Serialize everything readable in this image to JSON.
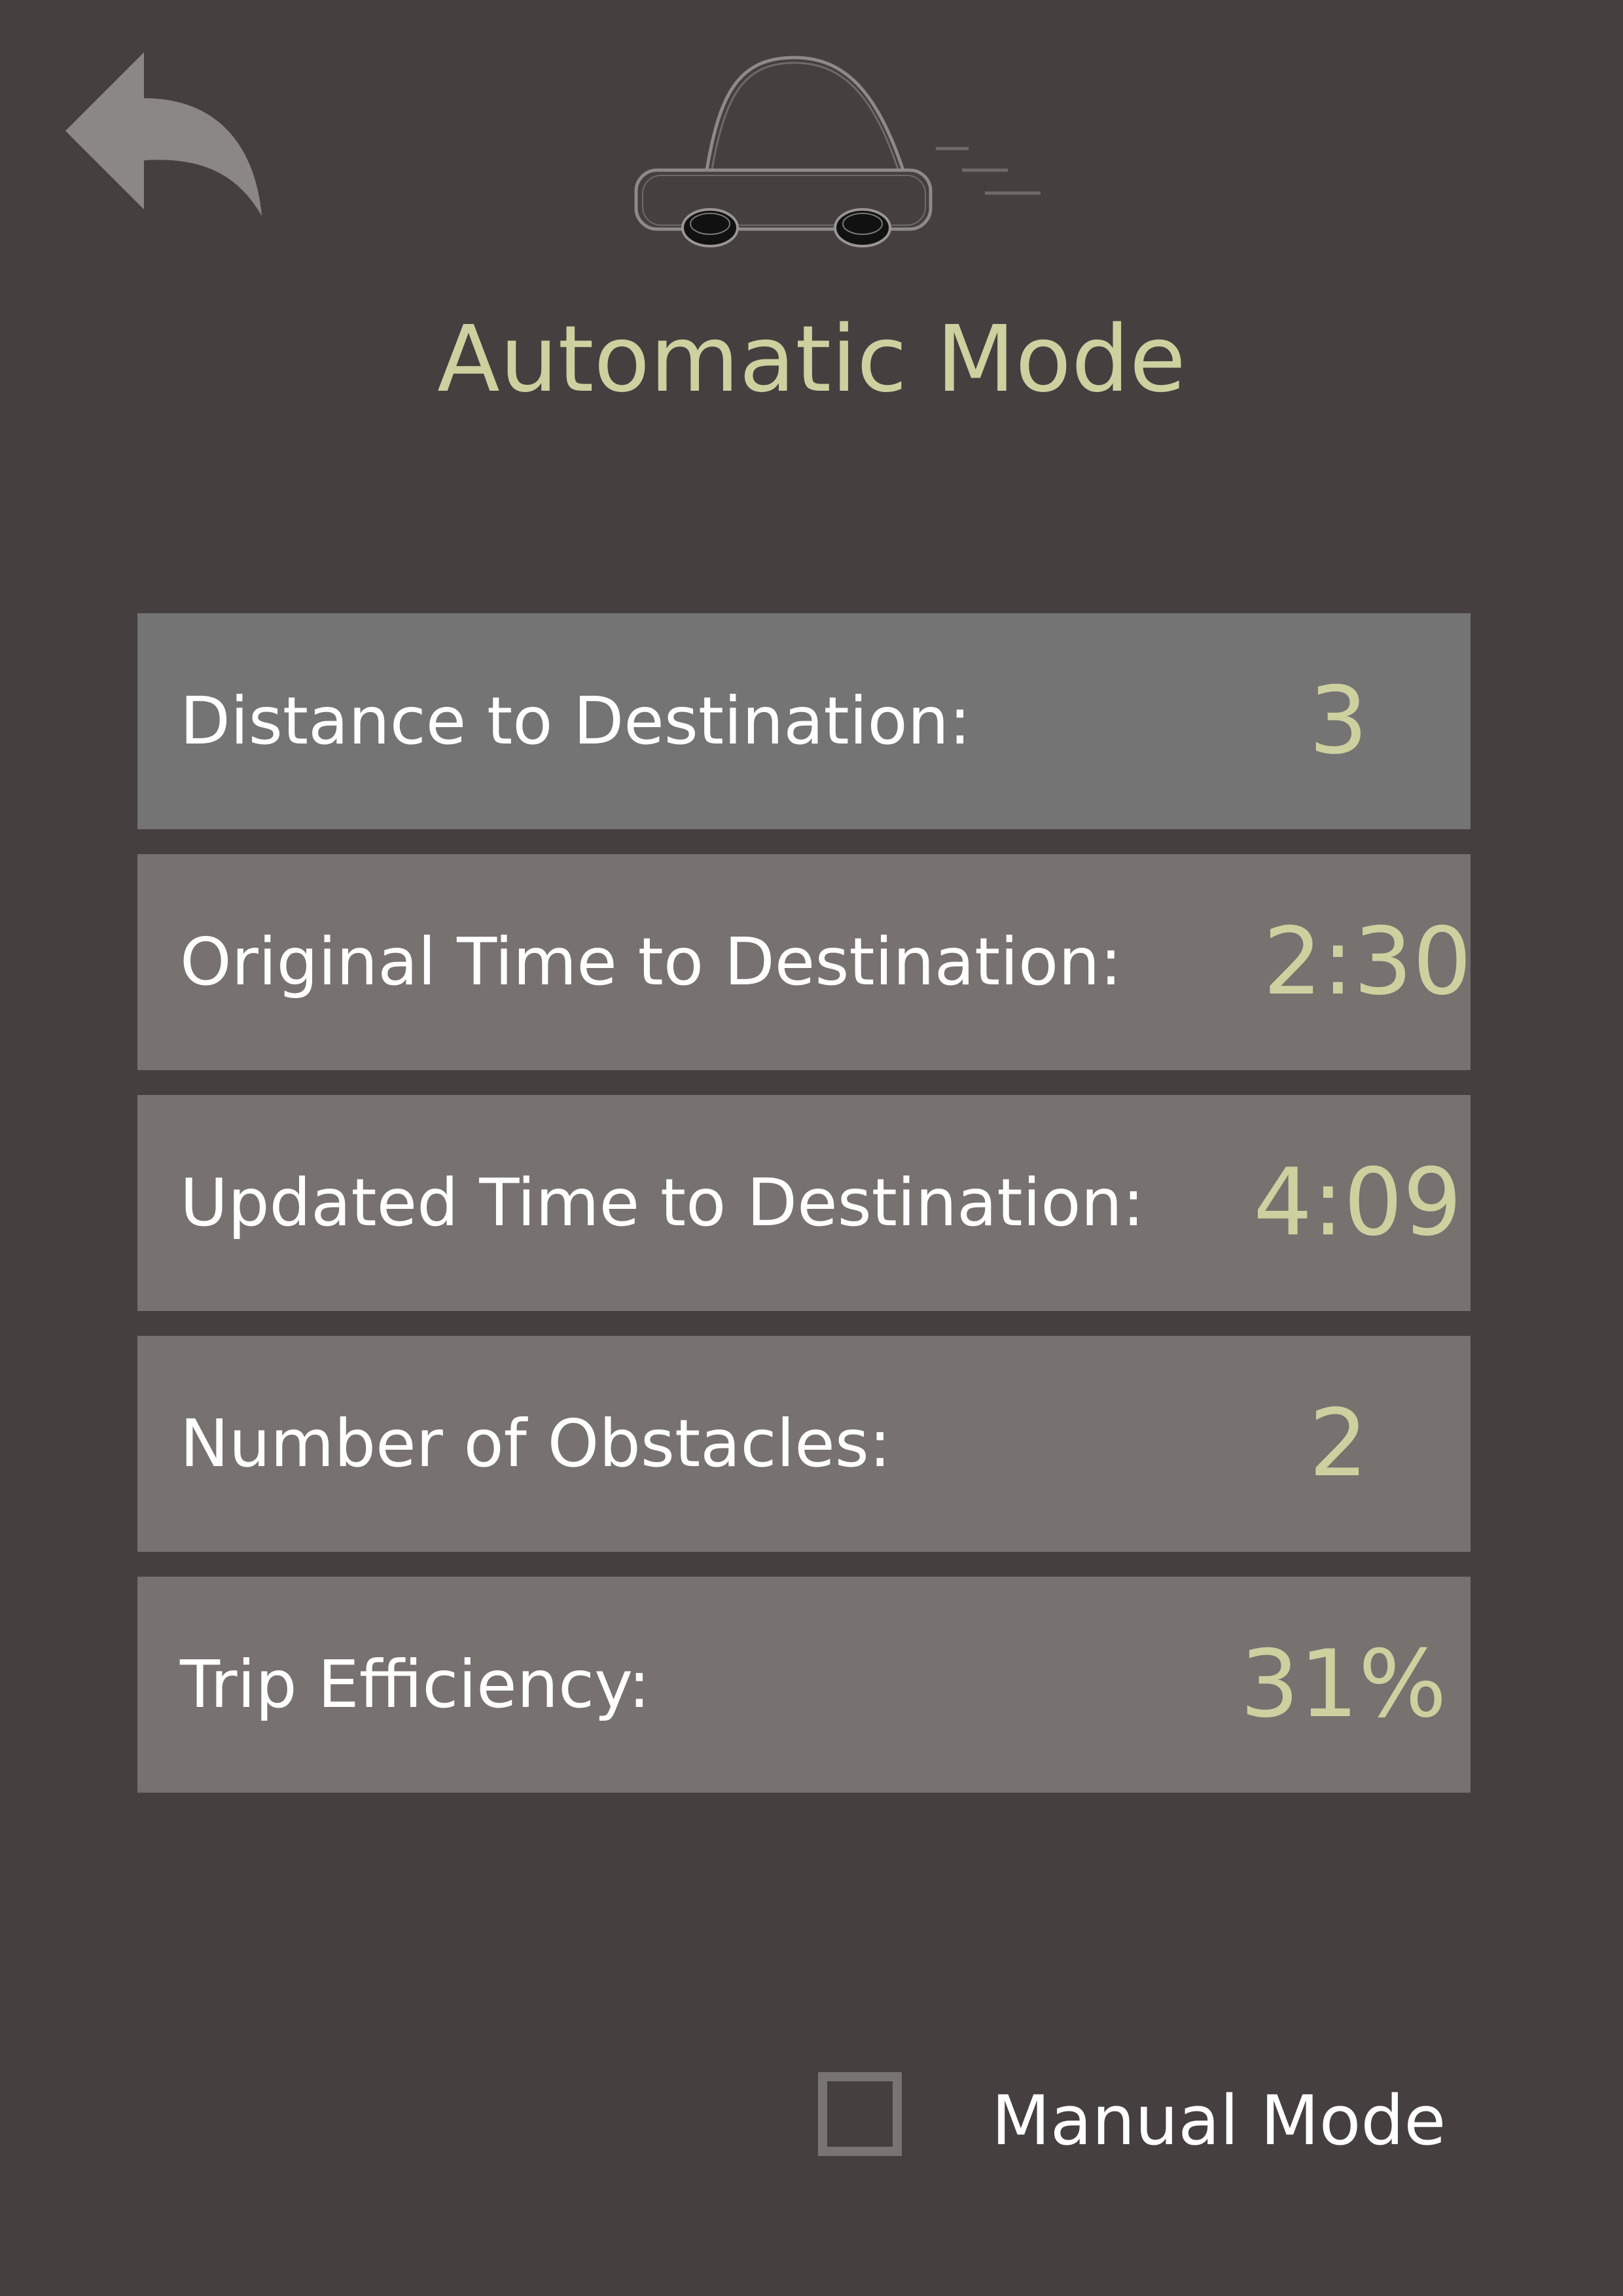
{
  "header": {
    "title": "Automatic Mode",
    "back_icon": "back-arrow-icon",
    "car_icon": "car-icon"
  },
  "stats": [
    {
      "label": "Distance to Destination:",
      "value": "3"
    },
    {
      "label": "Original Time to Destination:",
      "value": "2:30"
    },
    {
      "label": "Updated Time to Destination:",
      "value": "4:09"
    },
    {
      "label": "Number of Obstacles:",
      "value": "2"
    },
    {
      "label": "Trip Efficiency:",
      "value": "31%"
    }
  ],
  "mode_toggle": {
    "label": "Manual Mode",
    "checked": false
  },
  "colors": {
    "background": "#463f3f",
    "accent": "#ccd19f",
    "row_background": "#777170",
    "text": "#ffffff"
  }
}
